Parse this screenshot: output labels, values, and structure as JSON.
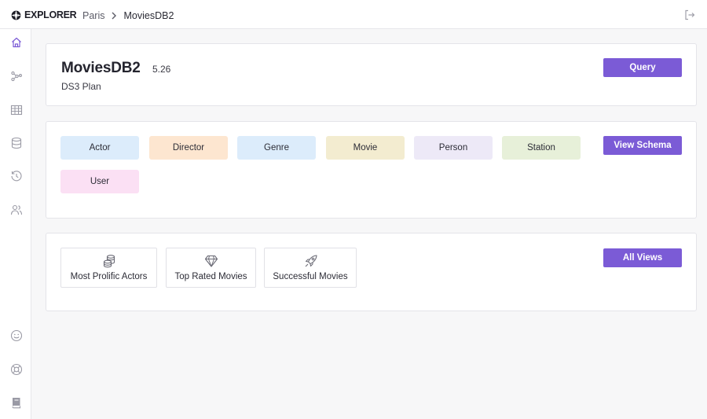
{
  "app": {
    "logo_text": "EXPLORER"
  },
  "breadcrumb": {
    "items": [
      "Paris",
      "MoviesDB2"
    ]
  },
  "sidebar": {
    "top_icons": [
      "home-icon",
      "graph-icon",
      "table-icon",
      "database-icon",
      "history-icon",
      "users-icon"
    ],
    "bottom_icons": [
      "smiley-icon",
      "lifebuoy-icon",
      "book-icon"
    ],
    "active": "home-icon"
  },
  "database": {
    "name": "MoviesDB2",
    "version": "5.26",
    "plan": "DS3 Plan",
    "query_label": "Query"
  },
  "schema": {
    "view_schema_label": "View Schema",
    "labels": [
      {
        "name": "Actor",
        "color": "#dcecfb"
      },
      {
        "name": "Director",
        "color": "#fde6d0"
      },
      {
        "name": "Genre",
        "color": "#dcecfb"
      },
      {
        "name": "Movie",
        "color": "#f3ecd0"
      },
      {
        "name": "Person",
        "color": "#ede9f7"
      },
      {
        "name": "Station",
        "color": "#e7f0d9"
      },
      {
        "name": "User",
        "color": "#fbe0f4"
      }
    ]
  },
  "views": {
    "all_views_label": "All Views",
    "items": [
      {
        "label": "Most Prolific Actors",
        "icon": "coins-icon"
      },
      {
        "label": "Top Rated Movies",
        "icon": "diamond-icon"
      },
      {
        "label": "Successful Movies",
        "icon": "rocket-icon"
      }
    ]
  },
  "colors": {
    "accent": "#7b5bd6"
  }
}
